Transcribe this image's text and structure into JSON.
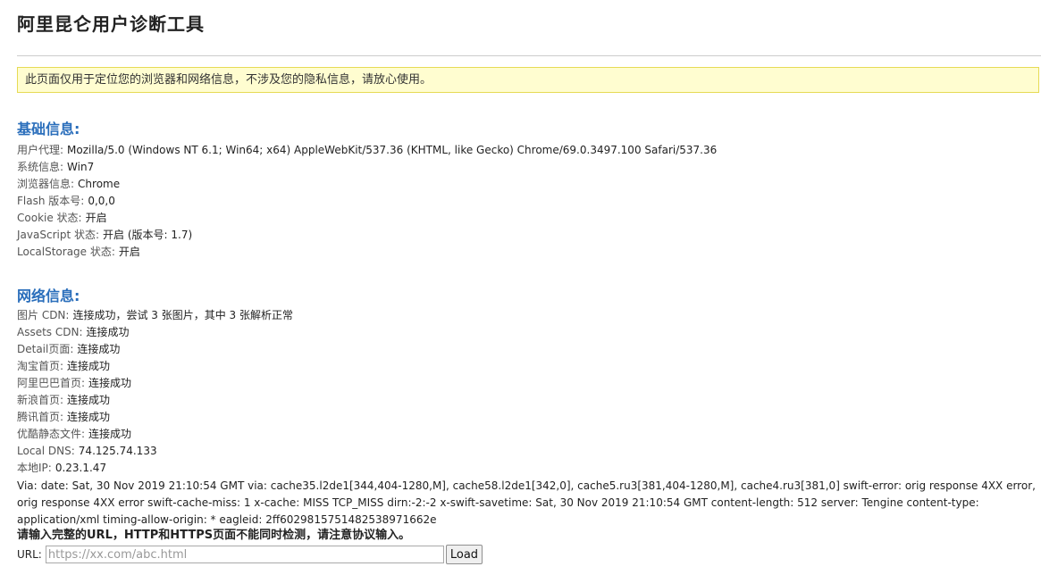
{
  "header": {
    "title": "阿里昆仑用户诊断工具"
  },
  "notice": {
    "text": "此页面仅用于定位您的浏览器和网络信息，不涉及您的隐私信息，请放心使用。"
  },
  "basic_info": {
    "heading": "基础信息:",
    "items": [
      {
        "label": "用户代理:",
        "value": "Mozilla/5.0 (Windows NT 6.1; Win64; x64) AppleWebKit/537.36 (KHTML, like Gecko) Chrome/69.0.3497.100 Safari/537.36"
      },
      {
        "label": "系统信息:",
        "value": "Win7"
      },
      {
        "label": "浏览器信息:",
        "value": "Chrome"
      },
      {
        "label": "Flash 版本号:",
        "value": "0,0,0"
      },
      {
        "label": "Cookie 状态:",
        "value": "开启"
      },
      {
        "label": "JavaScript 状态:",
        "value": "开启 (版本号: 1.7)"
      },
      {
        "label": "LocalStorage 状态:",
        "value": "开启"
      }
    ]
  },
  "network_info": {
    "heading": "网络信息:",
    "items": [
      {
        "label": "图片 CDN:",
        "value": "连接成功，尝试 3 张图片，其中 3 张解析正常"
      },
      {
        "label": "Assets CDN:",
        "value": "连接成功"
      },
      {
        "label": "Detail页面:",
        "value": "连接成功"
      },
      {
        "label": "淘宝首页:",
        "value": "连接成功"
      },
      {
        "label": "阿里巴巴首页:",
        "value": "连接成功"
      },
      {
        "label": "新浪首页:",
        "value": "连接成功"
      },
      {
        "label": "腾讯首页:",
        "value": "连接成功"
      },
      {
        "label": "优酷静态文件:",
        "value": "连接成功"
      },
      {
        "label": "Local DNS:",
        "value": "74.125.74.133"
      },
      {
        "label": "本地IP:",
        "value": "0.23.1.47"
      }
    ]
  },
  "via": {
    "label": "Via:",
    "text": "date: Sat, 30 Nov 2019 21:10:54 GMT via: cache35.l2de1[344,404-1280,M], cache58.l2de1[342,0], cache5.ru3[381,404-1280,M], cache4.ru3[381,0] swift-error: orig response 4XX error, orig response 4XX error swift-cache-miss: 1 x-cache: MISS TCP_MISS dirn:-2:-2 x-swift-savetime: Sat, 30 Nov 2019 21:10:54 GMT content-length: 512 server: Tengine content-type: application/xml timing-allow-origin: * eagleid: 2ff6029815751482538971662e"
  },
  "instruction": {
    "text": "请输入完整的URL，HTTP和HTTPS页面不能同时检测，请注意协议输入。"
  },
  "url_form": {
    "label": "URL:",
    "placeholder": "https://xx.com/abc.html",
    "value": "",
    "button_label": "Load"
  },
  "colors": {
    "heading_blue": "#2a6ebb",
    "notice_bg": "#fffdd0",
    "notice_border": "#e6db55"
  }
}
